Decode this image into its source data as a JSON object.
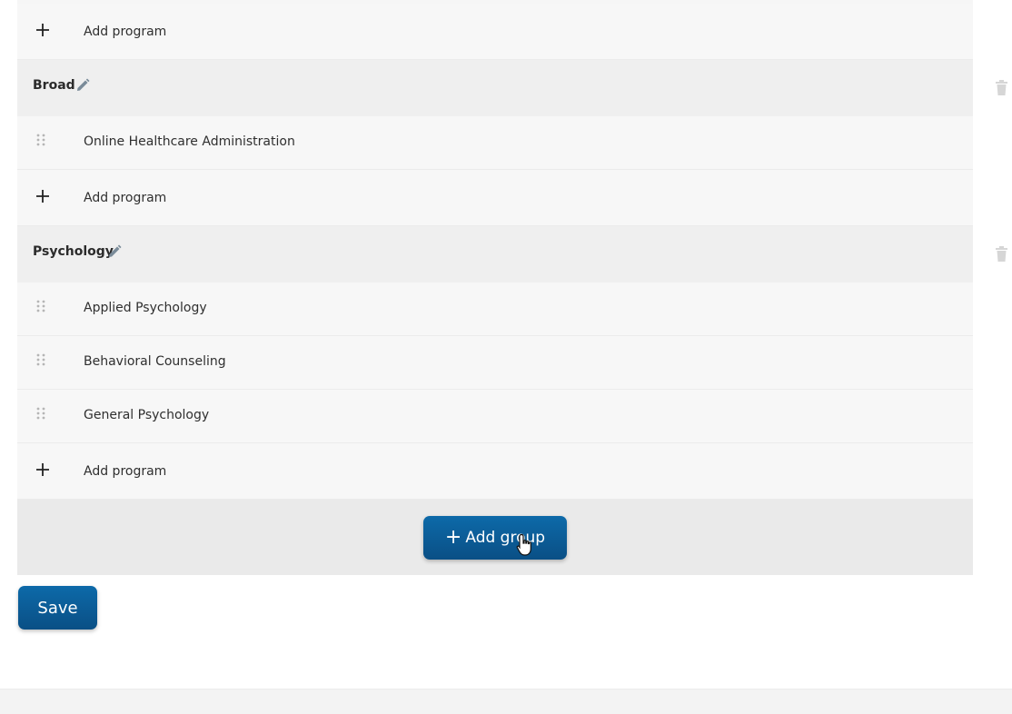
{
  "groups": [
    {
      "name": "",
      "programs": [],
      "add_label": "Add program"
    },
    {
      "name": "Broad",
      "programs": [
        "Online Healthcare Administration"
      ],
      "add_label": "Add program"
    },
    {
      "name": "Psychology",
      "programs": [
        "Applied Psychology",
        "Behavioral Counseling",
        "General Psychology"
      ],
      "add_label": "Add program"
    }
  ],
  "actions": {
    "add_group_label": "Add group",
    "save_label": "Save"
  },
  "icons": {
    "drag": "drag-handle-icon",
    "plus": "plus-icon",
    "edit": "pencil-icon",
    "delete": "trash-icon"
  },
  "colors": {
    "primary": "#0a5b97",
    "icon_muted": "#7a8b99"
  }
}
